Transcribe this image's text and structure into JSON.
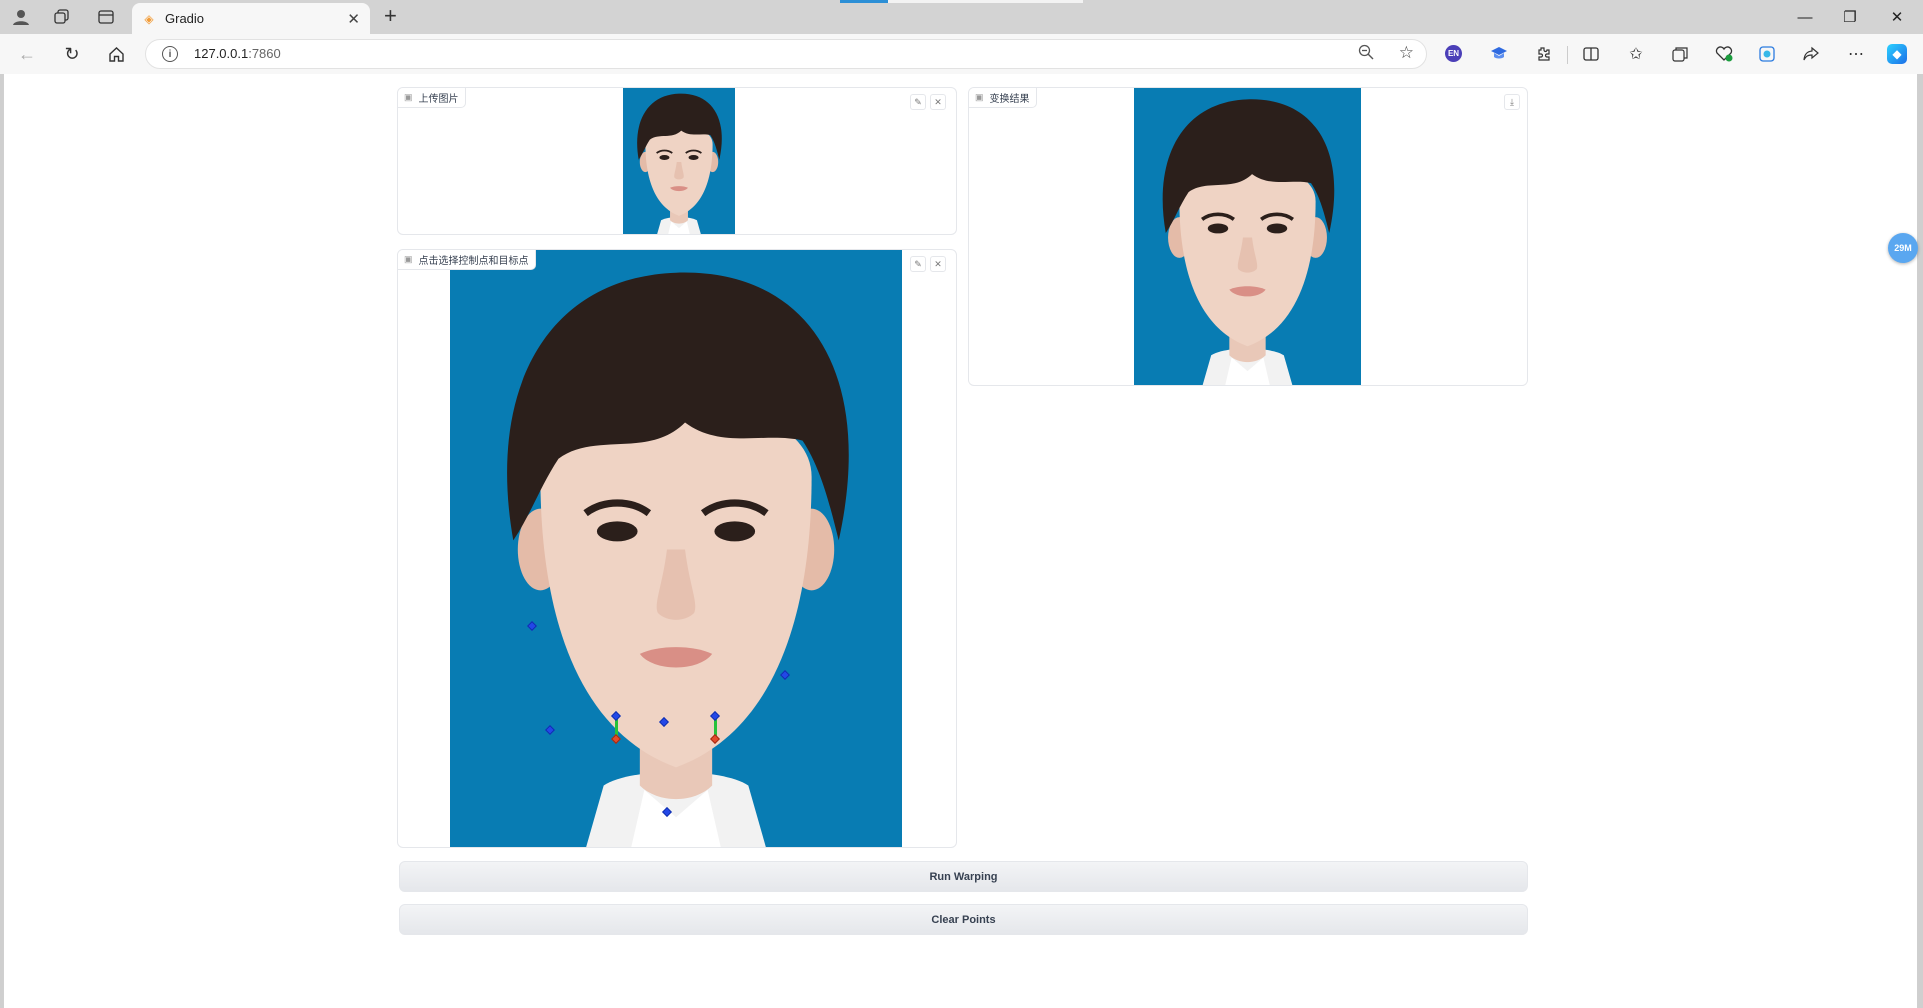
{
  "browser": {
    "tab_title": "Gradio",
    "new_tab_symbol": "+",
    "url_host": "127.0.0.1",
    "url_port": ":7860",
    "ext_en_label": "EN",
    "icons": [
      "profile-icon",
      "workspaces-icon",
      "tab-actions-icon",
      "back-icon",
      "refresh-icon",
      "home-icon",
      "info-icon",
      "zoom-out-icon",
      "favorite-star-icon",
      "extensions-icon",
      "split-screen-icon",
      "favorites-icon",
      "collections-icon",
      "browser-essentials-icon",
      "edge-bar-icon",
      "share-icon",
      "more-icon",
      "copilot-icon"
    ]
  },
  "page": {
    "floating_badge": "29M",
    "upload_panel_label": "上传图片",
    "select_panel_label": "点击选择控制点和目标点",
    "result_panel_label": "变换结果",
    "run_button": "Run Warping",
    "clear_button": "Clear Points"
  },
  "colors": {
    "photo_background": "#087cb3",
    "source_point": "#2348e8",
    "target_arrow": "#27c23a"
  }
}
